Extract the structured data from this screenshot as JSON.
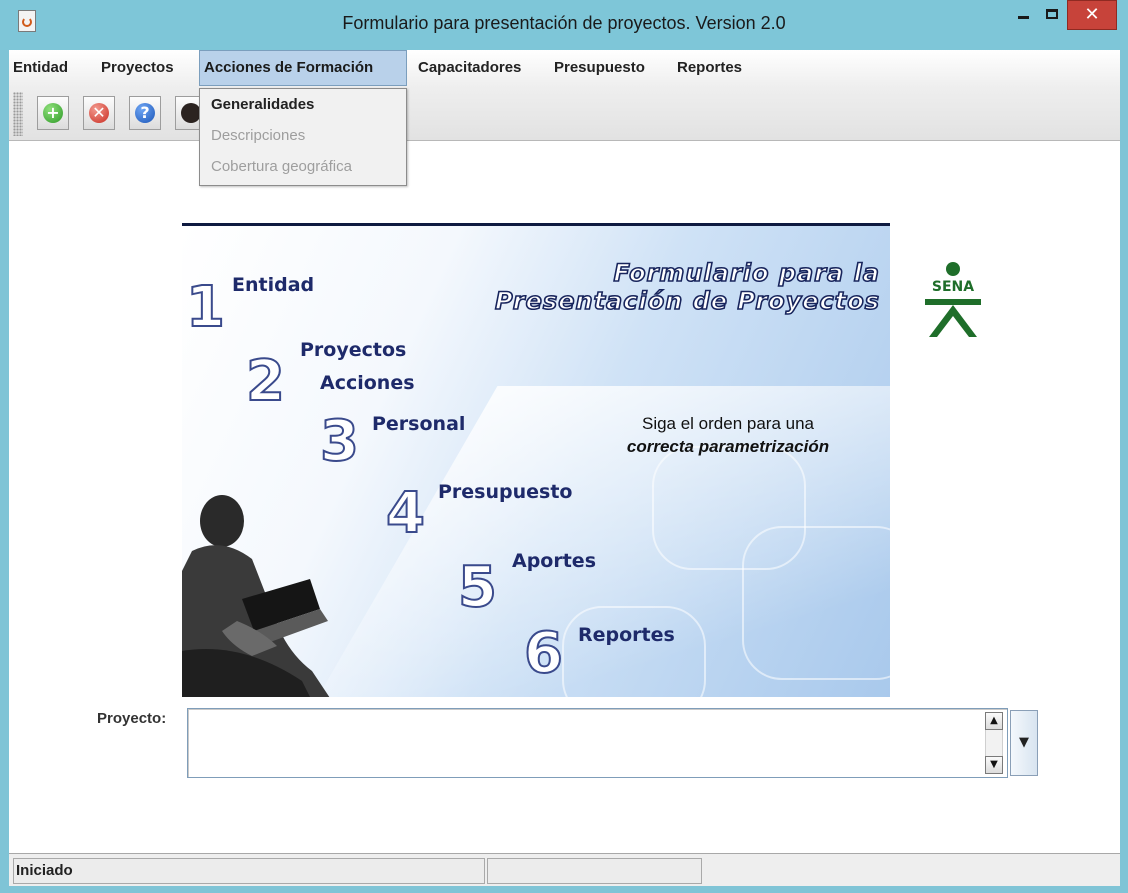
{
  "window": {
    "title": "Formulario para presentación de proyectos. Version 2.0",
    "icon": "java-app-icon",
    "controls": {
      "minimize": "minimize-icon",
      "maximize": "maximize-icon",
      "close": "✕"
    }
  },
  "menubar": {
    "items": [
      "Entidad",
      "Proyectos",
      "Acciones de Formación",
      "Capacitadores",
      "Presupuesto",
      "Reportes"
    ],
    "active_index": 2
  },
  "dropdown": {
    "items": [
      {
        "label": "Generalidades",
        "enabled": true
      },
      {
        "label": "Descripciones",
        "enabled": false
      },
      {
        "label": "Cobertura geográfica",
        "enabled": false
      }
    ]
  },
  "toolbar": {
    "buttons": [
      {
        "icon": "add-icon",
        "glyph": "+"
      },
      {
        "icon": "delete-icon",
        "glyph": "✕"
      },
      {
        "icon": "help-icon",
        "glyph": "?"
      },
      {
        "icon": "book-icon",
        "glyph": ""
      }
    ]
  },
  "banner": {
    "title_line1": "Formulario para la",
    "title_line2": "Presentación de Proyectos",
    "instruction_line1": "Siga el orden para una",
    "instruction_line2": "correcta parametrización",
    "steps": [
      {
        "number": "1",
        "label": "Entidad"
      },
      {
        "number": "2",
        "label": "Proyectos"
      },
      {
        "number": "",
        "label": "Acciones"
      },
      {
        "number": "3",
        "label": "Personal"
      },
      {
        "number": "4",
        "label": "Presupuesto"
      },
      {
        "number": "5",
        "label": "Aportes"
      },
      {
        "number": "6",
        "label": "Reportes"
      }
    ]
  },
  "logo": {
    "text": "SENA",
    "color": "#1f6e2a"
  },
  "project": {
    "label": "Proyecto:",
    "value": ""
  },
  "statusbar": {
    "cells": [
      "Iniciado",
      "",
      ""
    ]
  }
}
